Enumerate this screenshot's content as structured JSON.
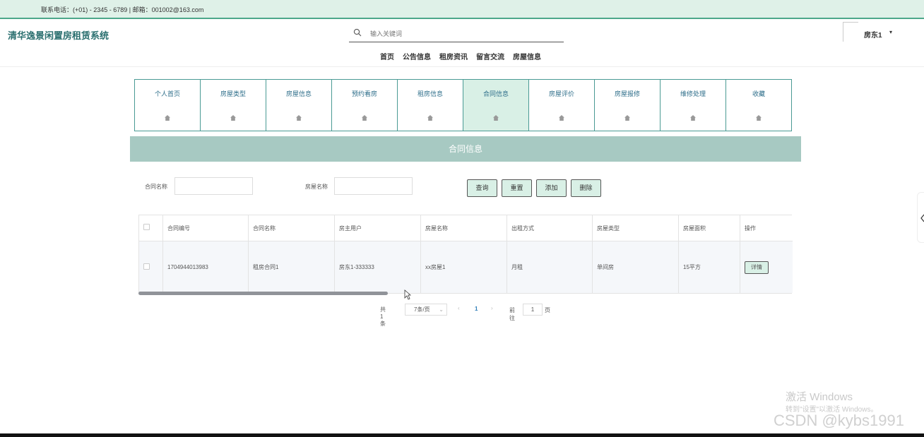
{
  "topbar": {
    "contact": "联系电话：(+01) - 2345 - 6789 | 邮箱：001002@163.com"
  },
  "header": {
    "site_title": "清华逸景闲置房租赁系统",
    "search_placeholder": "输入关键词",
    "nav": [
      "首页",
      "公告信息",
      "租房资讯",
      "留言交流",
      "房屋信息"
    ],
    "user_name": "房东1"
  },
  "menu": {
    "items": [
      "个人首页",
      "房屋类型",
      "房屋信息",
      "预约看房",
      "租房信息",
      "合同信息",
      "房屋评价",
      "房屋报修",
      "维修处理",
      "收藏"
    ],
    "active_index": 5
  },
  "banner": {
    "title": "合同信息"
  },
  "filters": {
    "contract_name_label": "合同名称",
    "house_name_label": "房屋名称",
    "buttons": {
      "query": "查询",
      "reset": "重置",
      "add": "添加",
      "delete": "删除"
    }
  },
  "table": {
    "headers": [
      "合同编号",
      "合同名称",
      "房主用户",
      "房屋名称",
      "出租方式",
      "房屋类型",
      "房屋面积",
      "操作"
    ],
    "rows": [
      {
        "cells": [
          "1704944013983",
          "租房合同1",
          "房东1-333333",
          "xx房屋1",
          "月租",
          "单间房",
          "15平方"
        ],
        "action": "详情"
      }
    ]
  },
  "pagination": {
    "total": "共 1 条",
    "page_size": "7条/页",
    "prev": "‹",
    "current_page": "1",
    "next": "›",
    "goto_label": "前往",
    "goto_value": "1",
    "page_suffix": "页"
  },
  "watermarks": {
    "windows_title": "激活 Windows",
    "windows_sub": "转到\"设置\"以激活 Windows。",
    "csdn": "CSDN @kybs1991"
  }
}
